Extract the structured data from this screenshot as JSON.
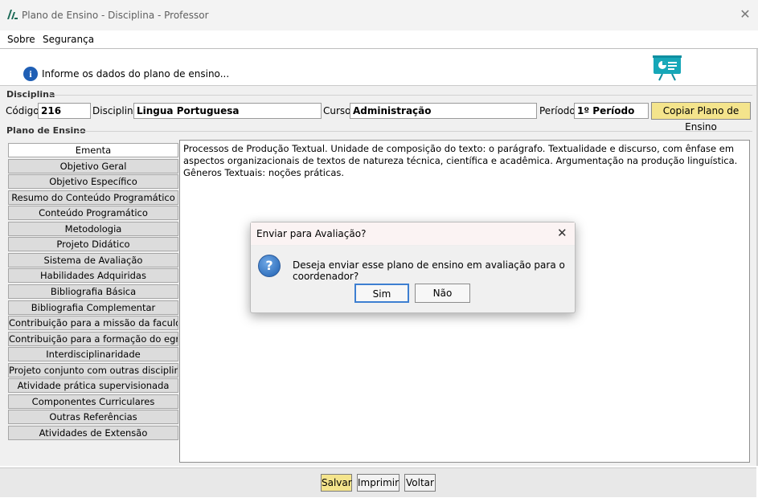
{
  "window": {
    "title": "Plano de Ensino - Disciplina - Professor",
    "close": "✕"
  },
  "menu": [
    "Sobre",
    "Segurança"
  ],
  "info": {
    "icon": "i",
    "text": "Informe os dados do plano de ensino..."
  },
  "disciplina": {
    "group_label": "Disciplina",
    "codigo_label": "Código:",
    "codigo_value": "216",
    "disciplina_label": "Disciplina:",
    "disciplina_value": "Lingua Portuguesa",
    "curso_label": "Curso:",
    "curso_value": "Administração",
    "periodo_label": "Período:",
    "periodo_value": "1º Período",
    "copy_button": "Copiar Plano de Ensino"
  },
  "plano": {
    "group_label": "Plano de Ensino",
    "tabs": [
      "Ementa",
      "Objetivo Geral",
      "Objetivo Específico",
      "Resumo do Conteúdo Programático",
      "Conteúdo Programático",
      "Metodologia",
      "Projeto Didático",
      "Sistema de Avaliação",
      "Habilidades Adquiridas",
      "Bibliografia Básica",
      "Bibliografia Complementar",
      "Contribuição para a missão da faculdade",
      "Contribuição para a formação do egresso",
      "Interdisciplinaridade",
      "Projeto conjunto com outras disciplinas",
      "Atividade prática supervisionada",
      "Componentes Curriculares",
      "Outras Referências",
      "Atividades de Extensão"
    ],
    "active_tab": "Ementa",
    "content": "Processos de Produção Textual. Unidade de composição do texto: o parágrafo. Textualidade e discurso, com ênfase em aspectos organizacionais de textos de natureza técnica, científica e acadêmica. Argumentação na produção linguística. Gêneros Textuais: noções práticas."
  },
  "buttons": {
    "salvar": "Salvar",
    "imprimir": "Imprimir",
    "voltar": "Voltar"
  },
  "dialog": {
    "title": "Enviar para Avaliação?",
    "close": "✕",
    "icon": "?",
    "message": "Deseja enviar esse plano de ensino em avaliação para o coordenador?",
    "yes": "Sim",
    "no": "Não"
  },
  "colors": {
    "copy_button": "#f4e48c",
    "salvar_button": "#f4e48c",
    "info_icon": "#1f5fb5"
  }
}
